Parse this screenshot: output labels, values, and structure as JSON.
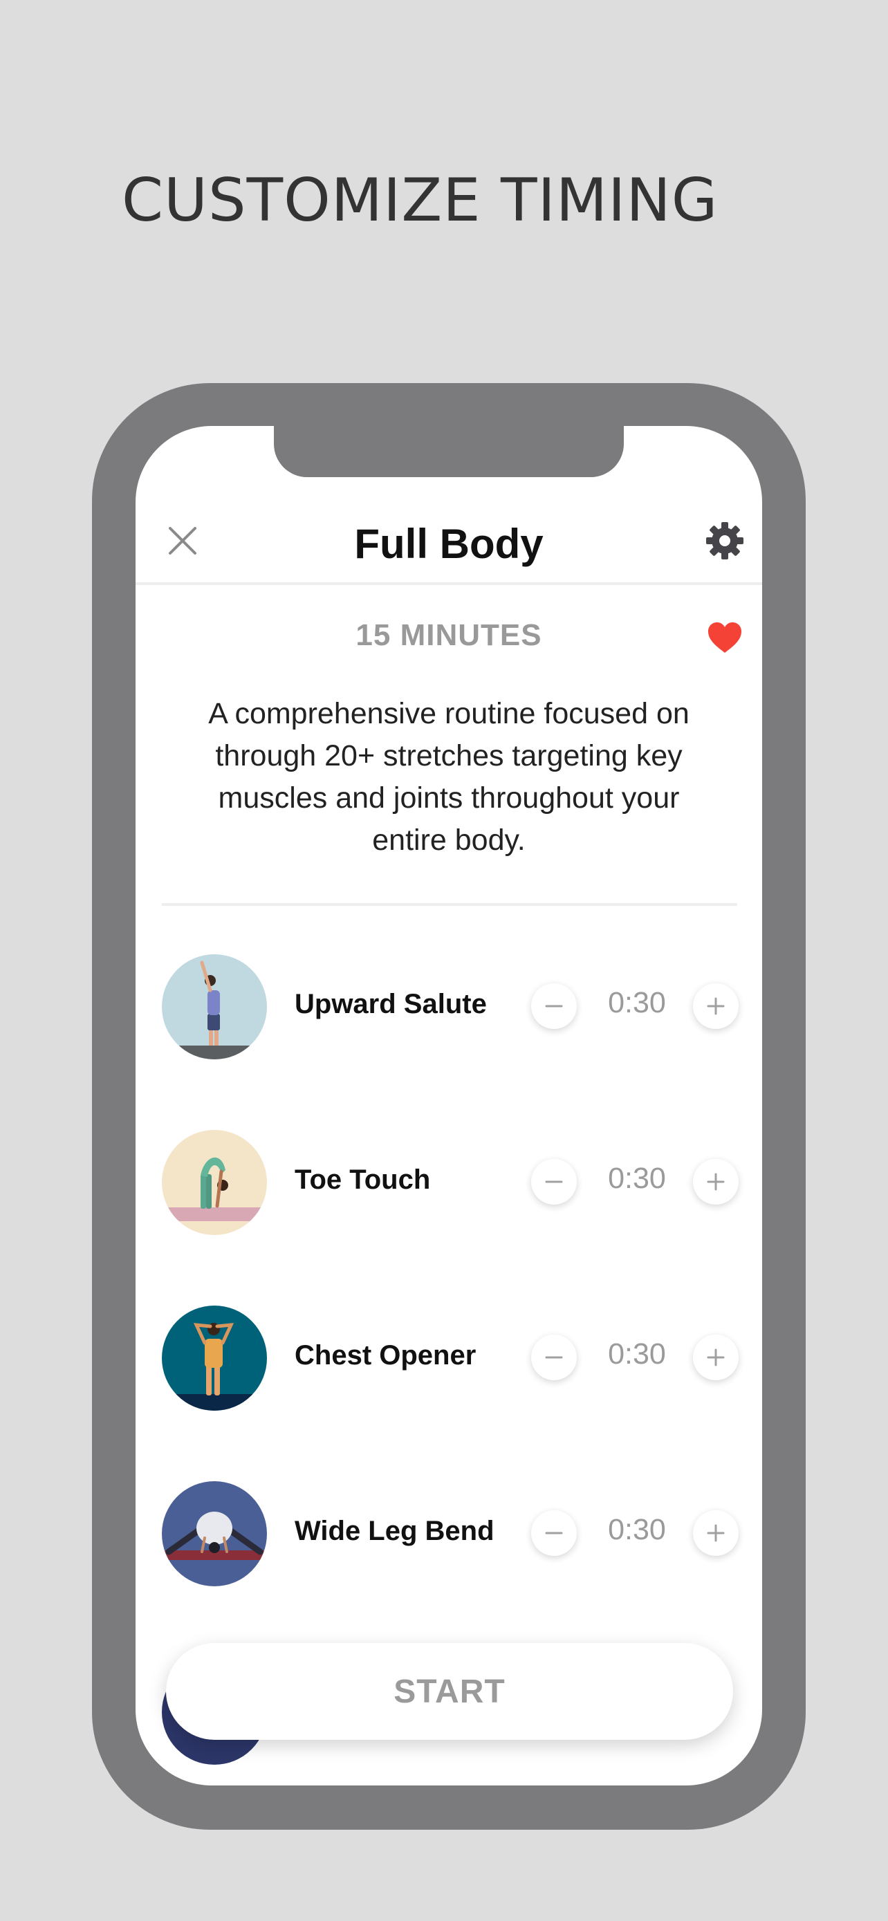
{
  "headline": "CUSTOMIZE TIMING",
  "nav": {
    "title": "Full Body",
    "close_icon": "close-icon",
    "settings_icon": "gear-icon"
  },
  "routine": {
    "duration": "15 MINUTES",
    "favorite_icon": "heart-icon",
    "favorite_color": "#f44336",
    "description": "A comprehensive routine focused on through 20+ stretches targeting key muscles and joints throughout your entire body."
  },
  "exercises": [
    {
      "name": "Upward Salute",
      "time": "0:30",
      "thumb_bg": "#c0d9e0"
    },
    {
      "name": "Toe Touch",
      "time": "0:30",
      "thumb_bg": "#f4e4c8"
    },
    {
      "name": "Chest Opener",
      "time": "0:30",
      "thumb_bg": "#006278"
    },
    {
      "name": "Wide Leg Bend",
      "time": "0:30",
      "thumb_bg": "#4a5f96"
    }
  ],
  "start_label": "START",
  "colors": {
    "background": "#dddddd",
    "phone_frame": "#7b7a7d",
    "text_muted": "#999999"
  }
}
